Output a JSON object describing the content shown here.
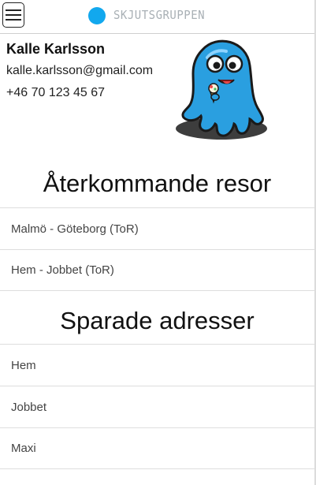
{
  "header": {
    "menu_icon": "hamburger-menu-icon",
    "logo_text": "SKJUTSGRUPPEN",
    "logo_color": "#12a8ee"
  },
  "profile": {
    "name": "Kalle Karlsson",
    "email": "kalle.karlsson@gmail.com",
    "phone": "+46 70 123 45 67",
    "mascot": "blue-octopus-mascot"
  },
  "recurring_trips": {
    "title": "Återkommande resor",
    "items": [
      {
        "label": "Malmö - Göteborg (ToR)"
      },
      {
        "label": "Hem - Jobbet (ToR)"
      }
    ]
  },
  "saved_addresses": {
    "title": "Sparade adresser",
    "items": [
      {
        "label": "Hem"
      },
      {
        "label": "Jobbet"
      },
      {
        "label": "Maxi"
      }
    ]
  }
}
